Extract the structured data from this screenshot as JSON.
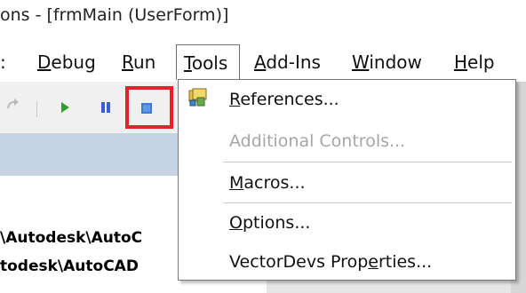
{
  "window": {
    "title": "ons - [frmMain (UserForm)]"
  },
  "menubar": {
    "items": [
      {
        "label": ":"
      },
      {
        "before": "",
        "acc": "D",
        "after": "ebug"
      },
      {
        "before": "",
        "acc": "R",
        "after": "un"
      },
      {
        "before": "",
        "acc": "T",
        "after": "ools"
      },
      {
        "before": "",
        "acc": "A",
        "after": "dd-Ins"
      },
      {
        "before": "",
        "acc": "W",
        "after": "indow"
      },
      {
        "before": "",
        "acc": "H",
        "after": "elp"
      }
    ]
  },
  "tools_menu": {
    "items": [
      {
        "before": "",
        "acc": "R",
        "after": "eferences...",
        "enabled": true,
        "icon": "references-icon"
      },
      {
        "label": "Additional Controls...",
        "enabled": false
      },
      {
        "before": "",
        "acc": "M",
        "after": "acros...",
        "enabled": true
      },
      {
        "before": "",
        "acc": "O",
        "after": "ptions...",
        "enabled": true
      },
      {
        "before": "VectorDevs Prop",
        "acc": "e",
        "after": "rties...",
        "enabled": true
      }
    ]
  },
  "left_panel": {
    "line1": "\\Autodesk\\AutoC",
    "line2": "todesk\\AutoCAD"
  },
  "colors": {
    "highlight": "#e8202a",
    "panel_blue": "#c5d3e3",
    "disabled_text": "#a6a6a6"
  }
}
